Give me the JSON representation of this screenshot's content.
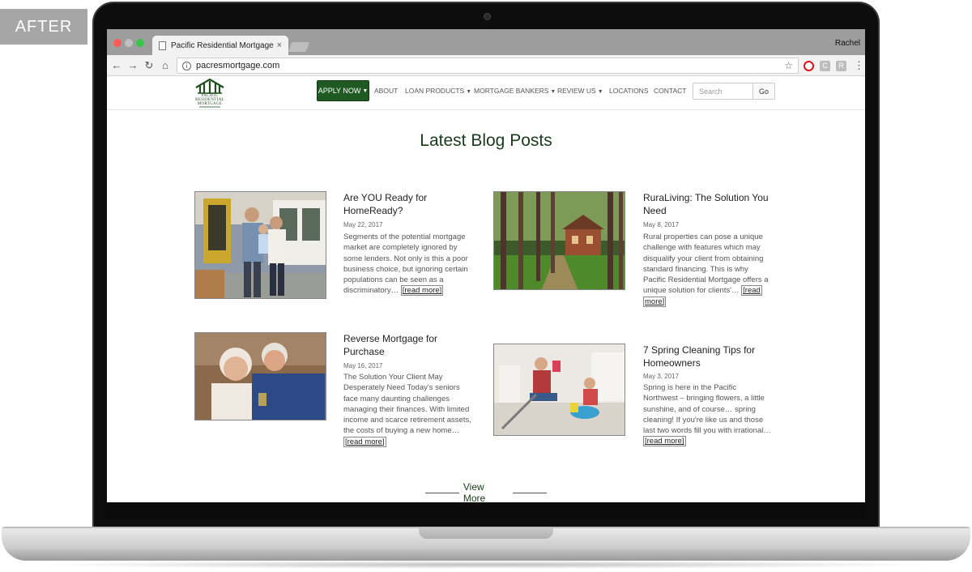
{
  "badge": {
    "label": "AFTER"
  },
  "browser": {
    "tab_title": "Pacific Residential Mortgage -",
    "tab_close": "×",
    "user_name": "Rachel",
    "url": "pacresmortgage.com",
    "icons": [
      "back-arrow-icon",
      "forward-arrow-icon",
      "reload-icon",
      "home-icon",
      "info-icon",
      "star-icon",
      "opera-icon",
      "extension-c-icon",
      "extension-r-icon",
      "menu-dots-icon"
    ],
    "ext_c": "C",
    "ext_r": "R"
  },
  "site": {
    "logo_text": [
      "PACIFIC",
      "RESIDENTIAL",
      "MORTGAGE"
    ],
    "nav": {
      "apply": "APPLY NOW",
      "about": "ABOUT",
      "loan_products": "LOAN PRODUCTS",
      "mortgage_bankers": "MORTGAGE BANKERS",
      "review_us": "REVIEW US",
      "locations": "LOCATIONS",
      "contact": "CONTACT",
      "search_placeholder": "Search",
      "go": "Go"
    },
    "heading": "Latest Blog Posts",
    "posts": [
      {
        "title_line1": "Are YOU Ready for",
        "title_line2": "HomeReady?",
        "date": "May 22, 2017",
        "body": [
          "Segments of the potential mortgage",
          "market are completely ignored by",
          "some lenders. Not only is this a poor",
          "business choice, but ignoring certain",
          "populations can be seen as a",
          "discriminatory…"
        ],
        "read_more": "[read more]"
      },
      {
        "title_line1": "RuraLiving: The Solution You",
        "title_line2": "Need",
        "date": "May 8, 2017",
        "body": [
          "Rural properties can pose a unique",
          "challenge with features which may",
          "disqualify your client from obtaining",
          "standard financing. This is why",
          "Pacific Residential Mortgage offers a",
          "unique solution for clients'…"
        ],
        "read_more_a": "[read",
        "read_more_b": "more]"
      },
      {
        "title_line1": "Reverse Mortgage for",
        "title_line2": "Purchase",
        "date": "May 16, 2017",
        "body": [
          "The Solution Your Client May",
          "Desperately Need Today's seniors",
          "face many daunting challenges",
          "managing their finances. With limited",
          "income and scarce retirement assets,",
          "the costs of buying a new home…"
        ],
        "read_more": "[read more]"
      },
      {
        "title_line1": "7 Spring Cleaning Tips for",
        "title_line2": "Homeowners",
        "date": "May 3, 2017",
        "body": [
          "Spring is here in the Pacific",
          "Northwest – bringing flowers, a little",
          "sunshine, and of course… spring",
          "cleaning! If you're like us and those",
          "last two words fill you with irrational…"
        ],
        "read_more": "[read more]"
      }
    ],
    "view_more": "View More"
  },
  "colors": {
    "brand_green": "#1e5a22",
    "heading_green": "#1b3a1b"
  }
}
